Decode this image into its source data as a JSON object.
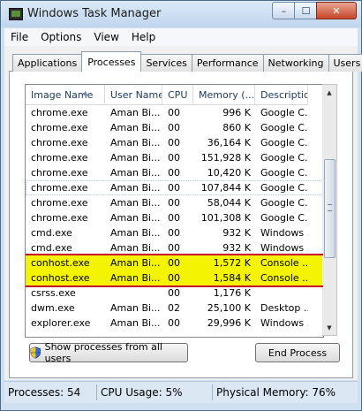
{
  "window": {
    "title": "Windows Task Manager",
    "min_glyph": "–",
    "max_glyph": "☐",
    "close_glyph": "✕"
  },
  "menu": [
    "File",
    "Options",
    "View",
    "Help"
  ],
  "tabs": [
    {
      "label": "Applications",
      "active": false
    },
    {
      "label": "Processes",
      "active": true
    },
    {
      "label": "Services",
      "active": false
    },
    {
      "label": "Performance",
      "active": false
    },
    {
      "label": "Networking",
      "active": false
    },
    {
      "label": "Users",
      "active": false
    }
  ],
  "table": {
    "columns": [
      "Image Name",
      "User Name",
      "CPU",
      "Memory (...",
      "Description"
    ],
    "sort_glyph": "▲",
    "rows": [
      {
        "image": "chrome.exe",
        "user": "Aman Bi...",
        "cpu": "00",
        "mem": "996 K",
        "desc": "Google C..."
      },
      {
        "image": "chrome.exe",
        "user": "Aman Bi...",
        "cpu": "00",
        "mem": "860 K",
        "desc": "Google C..."
      },
      {
        "image": "chrome.exe",
        "user": "Aman Bi...",
        "cpu": "00",
        "mem": "36,164 K",
        "desc": "Google C..."
      },
      {
        "image": "chrome.exe",
        "user": "Aman Bi...",
        "cpu": "00",
        "mem": "151,928 K",
        "desc": "Google C..."
      },
      {
        "image": "chrome.exe",
        "user": "Aman Bi...",
        "cpu": "00",
        "mem": "10,420 K",
        "desc": "Google C..."
      },
      {
        "image": "chrome.exe",
        "user": "Aman Bi...",
        "cpu": "00",
        "mem": "107,844 K",
        "desc": "Google C..."
      },
      {
        "image": "chrome.exe",
        "user": "Aman Bi...",
        "cpu": "00",
        "mem": "58,044 K",
        "desc": "Google C..."
      },
      {
        "image": "chrome.exe",
        "user": "Aman Bi...",
        "cpu": "00",
        "mem": "101,308 K",
        "desc": "Google C..."
      },
      {
        "image": "cmd.exe",
        "user": "Aman Bi...",
        "cpu": "00",
        "mem": "932 K",
        "desc": "Windows ..."
      },
      {
        "image": "cmd.exe",
        "user": "Aman Bi...",
        "cpu": "00",
        "mem": "932 K",
        "desc": "Windows ..."
      },
      {
        "image": "conhost.exe",
        "user": "Aman Bi...",
        "cpu": "00",
        "mem": "1,572 K",
        "desc": "Console ..."
      },
      {
        "image": "conhost.exe",
        "user": "Aman Bi...",
        "cpu": "00",
        "mem": "1,584 K",
        "desc": "Console ..."
      },
      {
        "image": "csrss.exe",
        "user": "",
        "cpu": "00",
        "mem": "1,176 K",
        "desc": ""
      },
      {
        "image": "dwm.exe",
        "user": "Aman Bi...",
        "cpu": "02",
        "mem": "25,100 K",
        "desc": "Desktop ..."
      },
      {
        "image": "explorer.exe",
        "user": "Aman Bi...",
        "cpu": "00",
        "mem": "29,996 K",
        "desc": "Windows ..."
      }
    ]
  },
  "buttons": {
    "show_all": "Show processes from all users",
    "end_process": "End Process"
  },
  "status": {
    "processes": "Processes: 54",
    "cpu": "CPU Usage: 5%",
    "memory": "Physical Memory: 76%"
  },
  "colors": {
    "highlight": "#f4f400",
    "highlight_border": "#c8002a"
  }
}
